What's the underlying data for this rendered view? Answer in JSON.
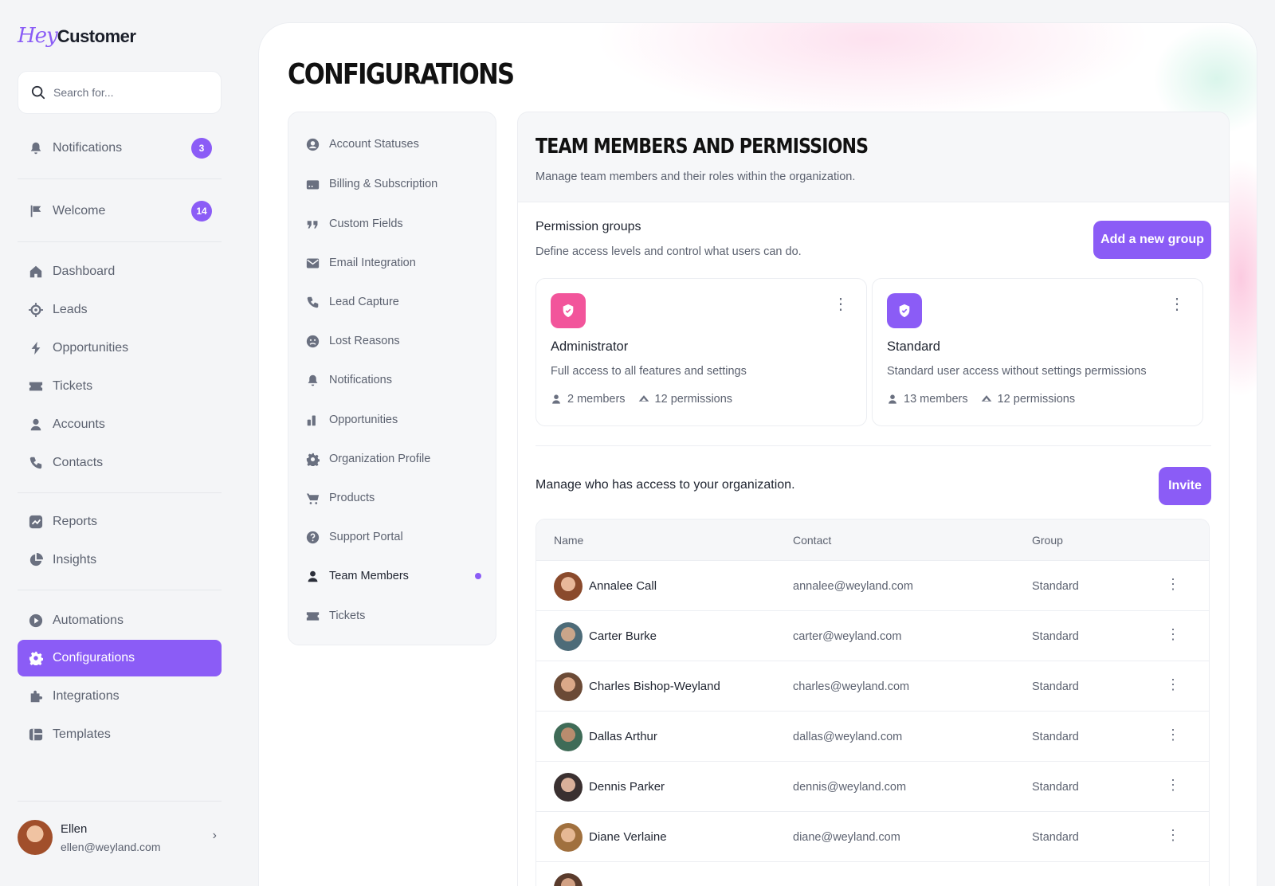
{
  "app": {
    "logo_hey": "Hey",
    "logo_customer": "Customer"
  },
  "sidebar": {
    "search_placeholder": "Search for...",
    "notifications": {
      "label": "Notifications",
      "badge": "3"
    },
    "welcome": {
      "label": "Welcome",
      "badge": "14"
    },
    "items": [
      {
        "label": "Dashboard",
        "icon": "home-icon"
      },
      {
        "label": "Leads",
        "icon": "target-icon"
      },
      {
        "label": "Opportunities",
        "icon": "bolt-icon"
      },
      {
        "label": "Tickets",
        "icon": "ticket-icon"
      },
      {
        "label": "Accounts",
        "icon": "user-icon"
      },
      {
        "label": "Contacts",
        "icon": "phone-icon"
      },
      {
        "label": "Reports",
        "icon": "chart-icon"
      },
      {
        "label": "Insights",
        "icon": "pie-icon"
      },
      {
        "label": "Automations",
        "icon": "play-icon"
      },
      {
        "label": "Configurations",
        "icon": "gear-icon",
        "active": true
      },
      {
        "label": "Integrations",
        "icon": "puzzle-icon"
      },
      {
        "label": "Templates",
        "icon": "template-icon"
      }
    ],
    "user": {
      "name": "Ellen",
      "email": "ellen@weyland.com"
    }
  },
  "page": {
    "title": "CONFIGURATIONS"
  },
  "config_nav": [
    {
      "label": "Account Statuses",
      "icon": "user-circle-icon"
    },
    {
      "label": "Billing & Subscription",
      "icon": "card-icon"
    },
    {
      "label": "Custom Fields",
      "icon": "quote-icon"
    },
    {
      "label": "Email Integration",
      "icon": "mail-icon"
    },
    {
      "label": "Lead Capture",
      "icon": "phone-icon"
    },
    {
      "label": "Lost Reasons",
      "icon": "sad-face-icon"
    },
    {
      "label": "Notifications",
      "icon": "bell-icon"
    },
    {
      "label": "Opportunities",
      "icon": "bars-icon"
    },
    {
      "label": "Organization Profile",
      "icon": "gear-icon"
    },
    {
      "label": "Products",
      "icon": "cart-icon"
    },
    {
      "label": "Support Portal",
      "icon": "help-icon"
    },
    {
      "label": "Team Members",
      "icon": "user-icon",
      "active": true
    },
    {
      "label": "Tickets",
      "icon": "ticket-icon"
    }
  ],
  "panel": {
    "title": "TEAM MEMBERS AND PERMISSIONS",
    "subtitle": "Manage team members and their roles within the organization.",
    "groups_title": "Permission groups",
    "groups_subtitle": "Define access levels and control what users can do.",
    "add_group_label": "Add a new group",
    "groups": [
      {
        "name": "Administrator",
        "description": "Full access to all features and settings",
        "members": "2 members",
        "permissions": "12 permissions",
        "color": "#f2559b"
      },
      {
        "name": "Standard",
        "description": "Standard user access without settings permissions",
        "members": "13 members",
        "permissions": "12 permissions",
        "color": "#8b5cf6"
      }
    ],
    "manage_text": "Manage who has access to your organization.",
    "invite_label": "Invite",
    "table": {
      "columns": [
        "Name",
        "Contact",
        "Group"
      ],
      "rows": [
        {
          "name": "Annalee Call",
          "email": "annalee@weyland.com",
          "group": "Standard"
        },
        {
          "name": "Carter Burke",
          "email": "carter@weyland.com",
          "group": "Standard"
        },
        {
          "name": "Charles Bishop-Weyland",
          "email": "charles@weyland.com",
          "group": "Standard"
        },
        {
          "name": "Dallas Arthur",
          "email": "dallas@weyland.com",
          "group": "Standard"
        },
        {
          "name": "Dennis Parker",
          "email": "dennis@weyland.com",
          "group": "Standard"
        },
        {
          "name": "Diane Verlaine",
          "email": "diane@weyland.com",
          "group": "Standard"
        }
      ]
    }
  },
  "colors": {
    "accent": "#8b5cf6",
    "admin_icon": "#f2559b"
  }
}
